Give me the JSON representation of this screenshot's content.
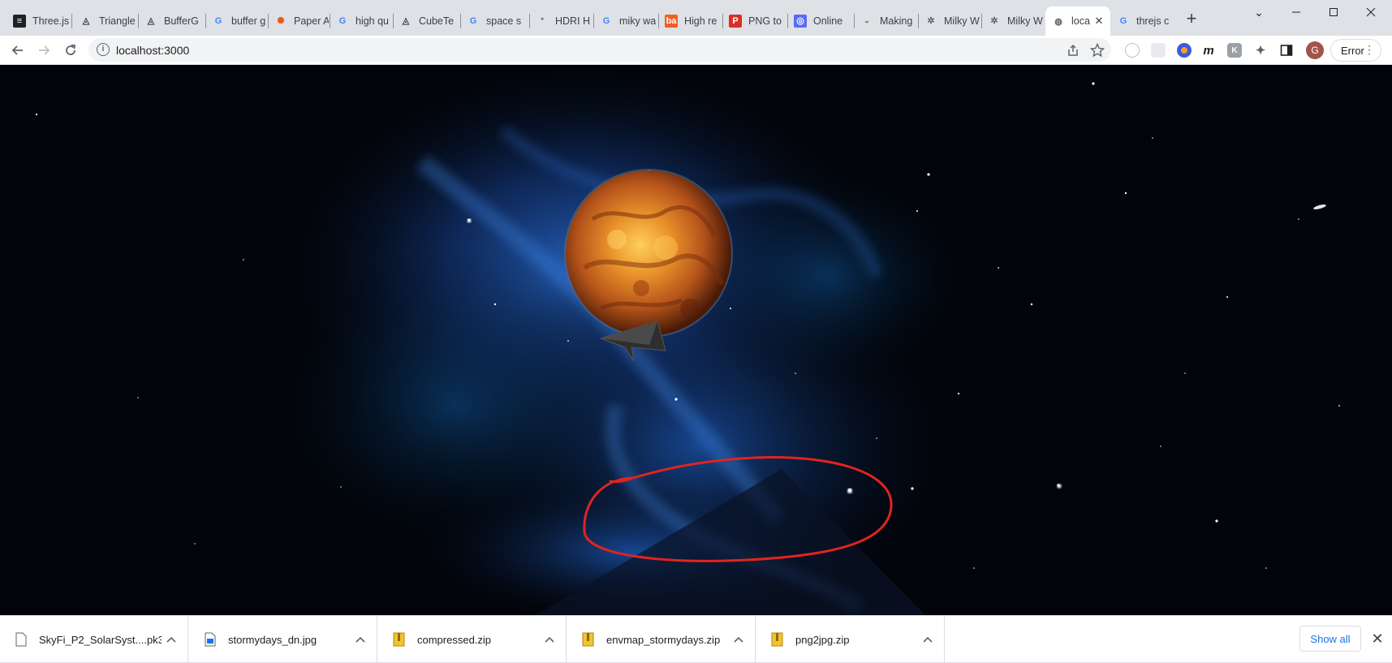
{
  "tabs": [
    {
      "title": "Three.js",
      "icon": "threejs-doc-icon"
    },
    {
      "title": "Triangle",
      "icon": "threejs-triangle-icon"
    },
    {
      "title": "BufferG",
      "icon": "threejs-triangle-icon"
    },
    {
      "title": "buffer g",
      "icon": "google-icon"
    },
    {
      "title": "Paper A",
      "icon": "pinwheel-icon"
    },
    {
      "title": "high qu",
      "icon": "google-icon"
    },
    {
      "title": "CubeTe",
      "icon": "threejs-triangle-icon"
    },
    {
      "title": "space s",
      "icon": "google-icon"
    },
    {
      "title": "HDRI H",
      "icon": "hdri-haven-icon"
    },
    {
      "title": "miky wa",
      "icon": "google-icon"
    },
    {
      "title": "High re",
      "icon": "pixabay-icon"
    },
    {
      "title": "PNG to",
      "icon": "png-jpg-icon"
    },
    {
      "title": "Online",
      "icon": "online-converter-icon"
    },
    {
      "title": "Making",
      "icon": "android-icon"
    },
    {
      "title": "Milky W",
      "icon": "unity-icon"
    },
    {
      "title": "Milky W",
      "icon": "unity-icon"
    },
    {
      "title": "loca",
      "icon": "globe-icon",
      "active": true
    },
    {
      "title": "threjs c",
      "icon": "google-icon"
    }
  ],
  "toolbar": {
    "url": "localhost:3000",
    "error_label": "Error",
    "avatar_letter": "G"
  },
  "downloads": [
    {
      "name": "SkyFi_P2_SolarSyst....pk3",
      "type": "file"
    },
    {
      "name": "stormydays_dn.jpg",
      "type": "image"
    },
    {
      "name": "compressed.zip",
      "type": "zip"
    },
    {
      "name": "envmap_stormydays.zip",
      "type": "zip"
    },
    {
      "name": "png2jpg.zip",
      "type": "zip"
    }
  ],
  "shelf": {
    "show_all": "Show all"
  },
  "colors": {
    "annotation": "#e0241f",
    "nebula": "#1a4fa8",
    "planet": "#d2691e",
    "link": "#1a73e8"
  }
}
